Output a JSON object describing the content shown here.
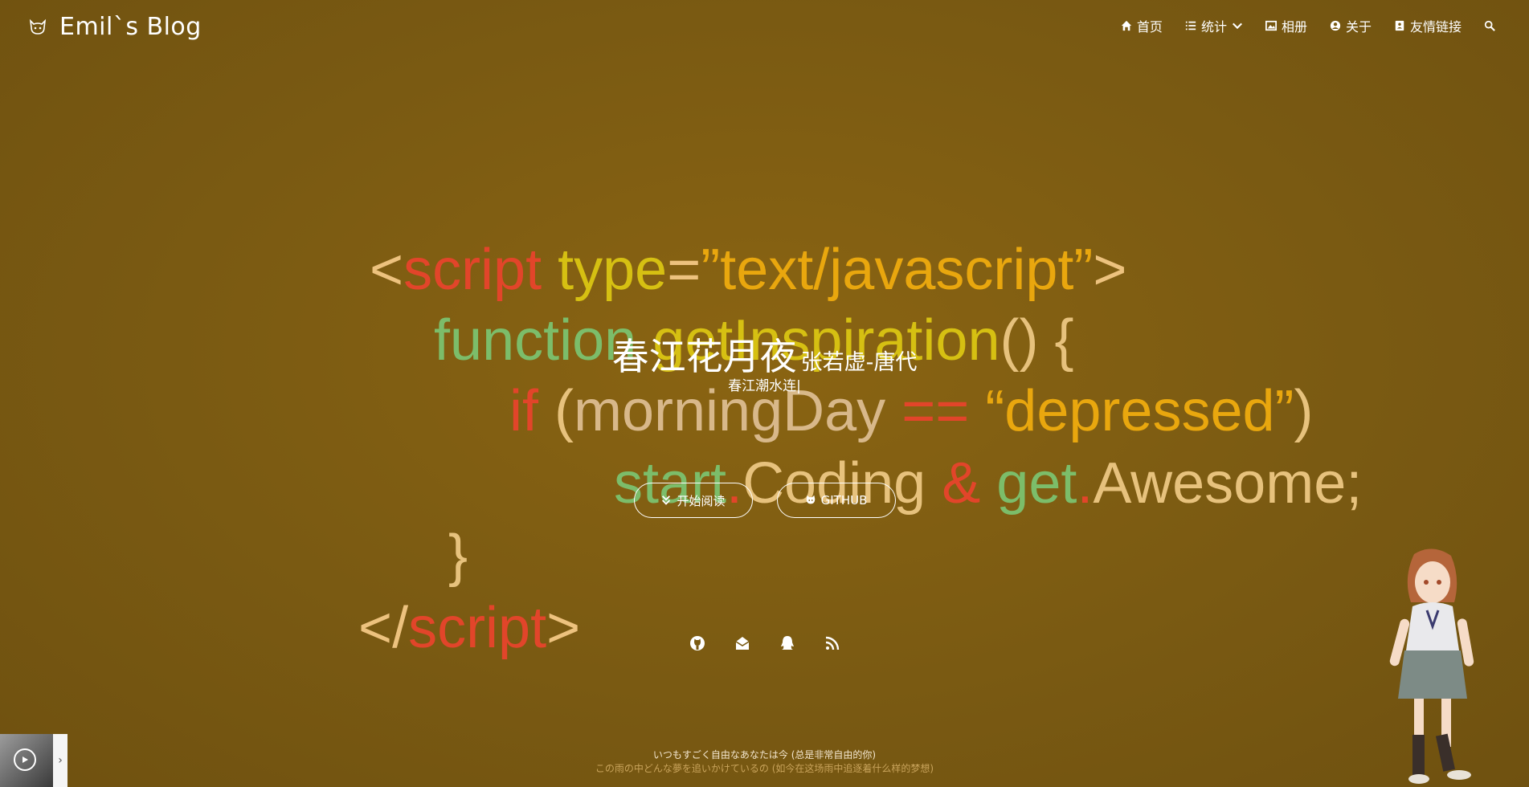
{
  "site": {
    "title": "Emil`s Blog",
    "logo_icon": "cat-logo-icon"
  },
  "nav": {
    "items": [
      {
        "label": "首页",
        "icon": "home-icon"
      },
      {
        "label": "统计",
        "icon": "list-icon",
        "dropdown": true
      },
      {
        "label": "相册",
        "icon": "image-icon"
      },
      {
        "label": "关于",
        "icon": "user-circle-icon"
      },
      {
        "label": "友情链接",
        "icon": "address-book-icon"
      }
    ],
    "search_icon": "search-icon"
  },
  "code_background": {
    "line1": {
      "lt": "<",
      "tag": "script",
      "attr": "type",
      "eq": "=",
      "val": "”text/javascript”",
      "gt": ">"
    },
    "line2": {
      "kw": "function",
      "fn": "getInspiration",
      "paren": "()",
      "brace": "{"
    },
    "line3": {
      "kw": "if",
      "open": "(",
      "var": "morningDay",
      "op": "==",
      "str": "“depressed”",
      "close": ")"
    },
    "line4": {
      "a": "start",
      "dot1": ".",
      "b": "Coding",
      "amp": "&",
      "c": "get",
      "dot2": ".",
      "d": "Awesome;"
    },
    "line5": {
      "brace": "}"
    },
    "line6": {
      "lt": "</",
      "tag": "script",
      "gt": ">"
    }
  },
  "hero": {
    "title": "春江花月夜",
    "author": "张若虚-唐代",
    "subtitle": "春江潮水连|"
  },
  "buttons": {
    "read": {
      "label": "开始阅读",
      "icon": "double-chevron-down-icon"
    },
    "github": {
      "label": "GITHUB",
      "icon": "github-icon"
    }
  },
  "social": [
    "github-icon",
    "mail-icon",
    "qq-icon",
    "rss-icon"
  ],
  "footer": {
    "line1": "いつもすごく自由なあなたは今 (总是非常自由的你)",
    "line2": "この雨の中どんな夢を追いかけているの (如今在这场雨中追逐着什么样的梦想)"
  },
  "player": {
    "play_icon": "play-icon",
    "toggle_icon": "chevron-right-icon"
  },
  "colors": {
    "background": "#7a5a12",
    "red": "#e2452a",
    "yellow": "#d6c012",
    "orange": "#e9a70e",
    "green": "#7cbd6a"
  }
}
